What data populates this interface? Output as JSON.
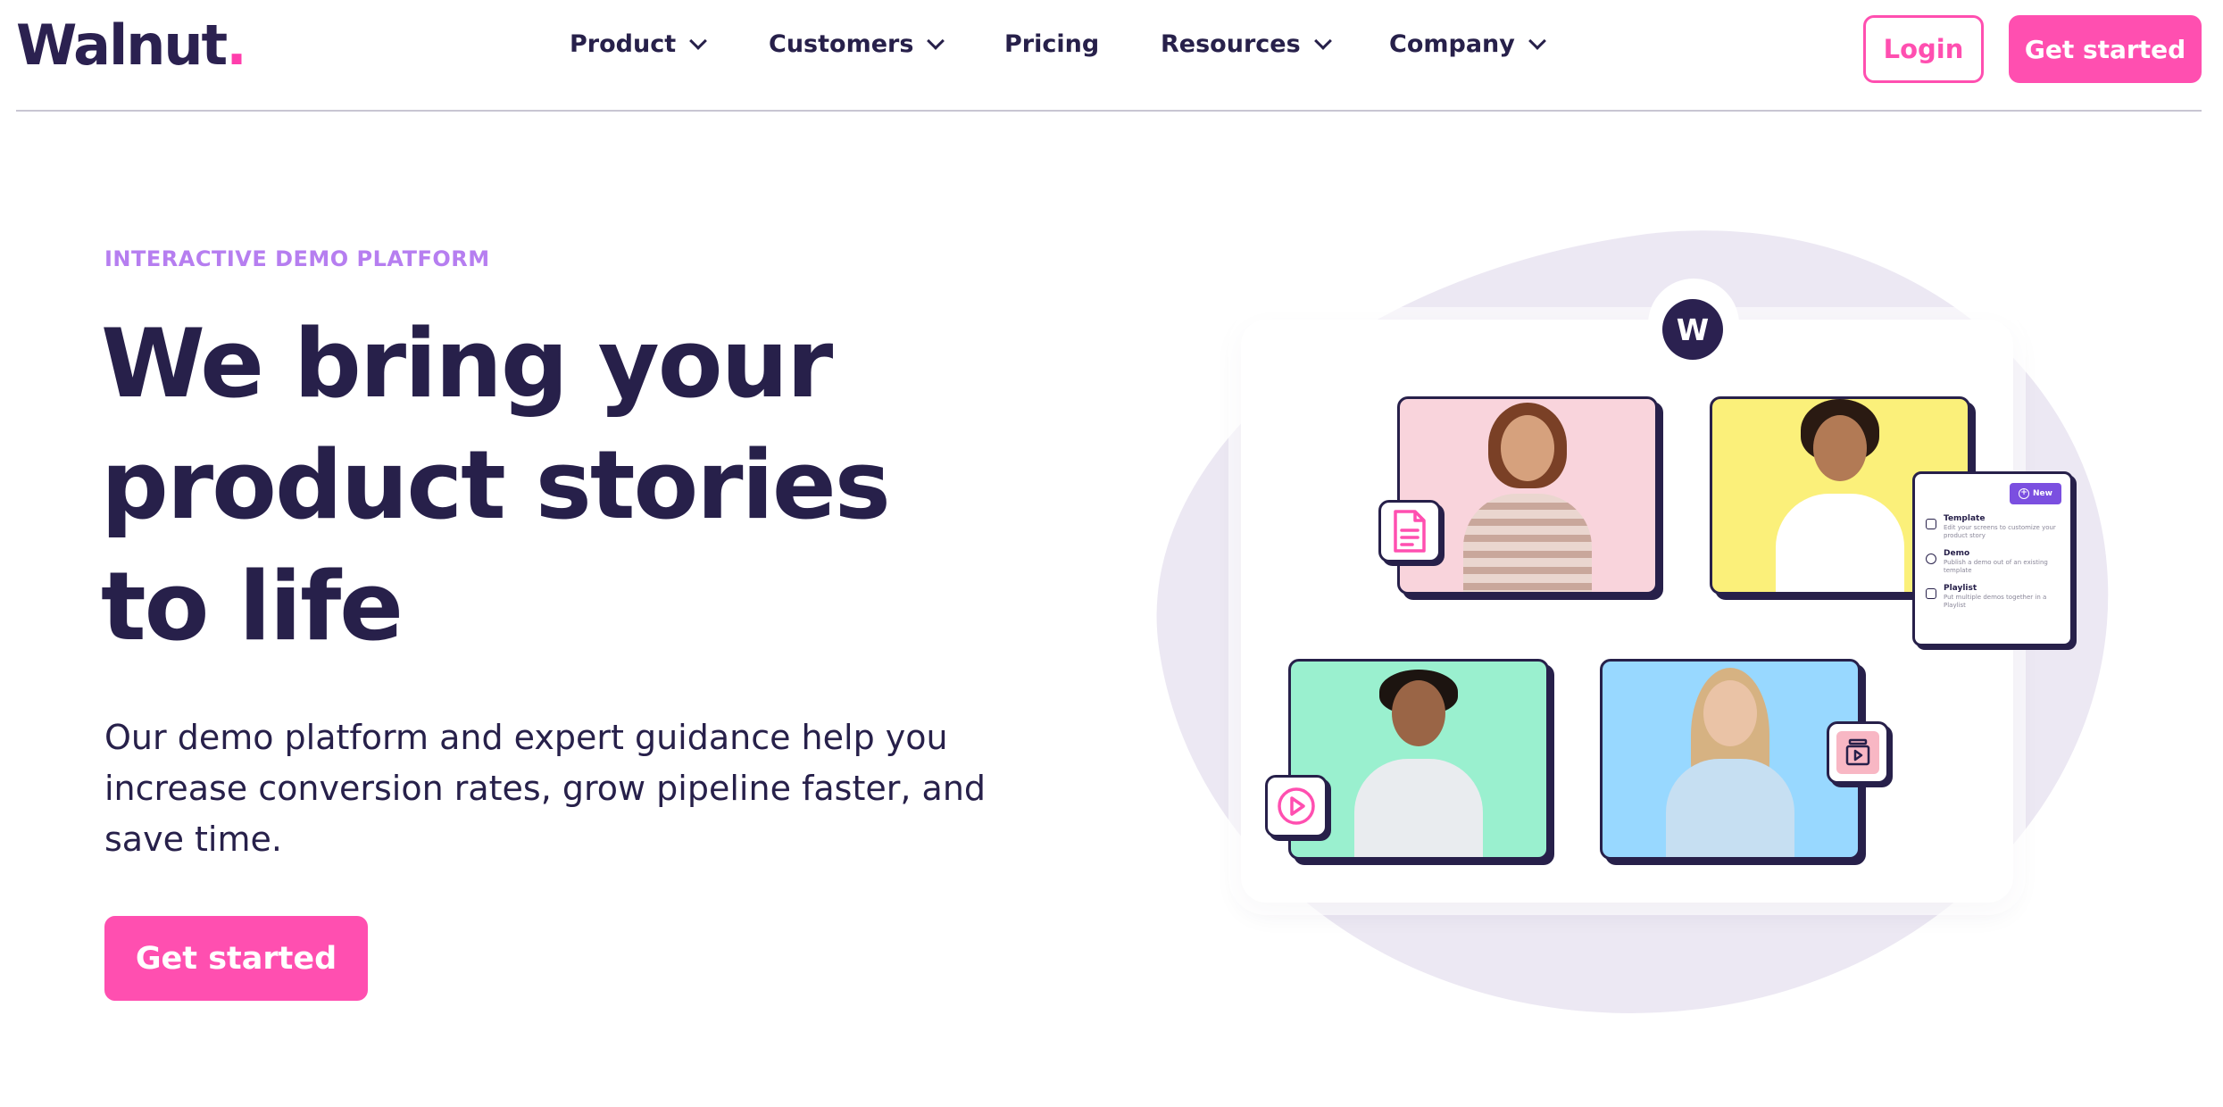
{
  "brand": {
    "logo_text": "Walnut",
    "logo_dot": ".",
    "accent": "#ff4fb0",
    "dark": "#27204a",
    "eyebrow_color": "#b67ef0"
  },
  "nav": {
    "items": [
      {
        "label": "Product",
        "has_dropdown": true
      },
      {
        "label": "Customers",
        "has_dropdown": true
      },
      {
        "label": "Pricing",
        "has_dropdown": false
      },
      {
        "label": "Resources",
        "has_dropdown": true
      },
      {
        "label": "Company",
        "has_dropdown": true
      }
    ],
    "login_label": "Login",
    "get_started_label": "Get started"
  },
  "hero": {
    "eyebrow": "INTERACTIVE DEMO PLATFORM",
    "headline_lines": [
      "We bring your",
      "product stories",
      "to life"
    ],
    "subtext": "Our demo platform and expert guidance help you increase conversion rates, grow pipeline faster, and save time.",
    "cta_label": "Get started"
  },
  "illustration": {
    "badge_letter": "W",
    "menu": {
      "new_label": "New",
      "items": [
        {
          "title": "Template",
          "desc": "Edit your screens to customize your product story"
        },
        {
          "title": "Demo",
          "desc": "Publish a demo out of an existing template"
        },
        {
          "title": "Playlist",
          "desc": "Put multiple demos together in a Playlist"
        }
      ]
    },
    "icons": [
      "document-icon",
      "play-icon",
      "stack-icon"
    ]
  }
}
